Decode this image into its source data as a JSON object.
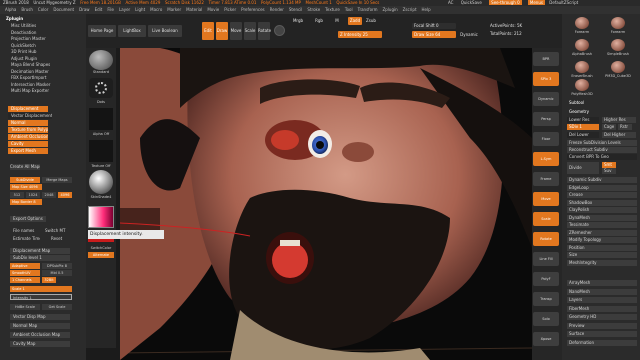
{
  "titlebar": {
    "app": "ZBrush 2018",
    "doc": "Uncut Mygeometry Z",
    "free_mem": "Free Mem 18.201GB",
    "active_mem": "Active Mem 4029",
    "scratch": "Scratch Disk 11622",
    "timer": "Timer 7.813 ATime 0.01",
    "polycount": "PolyCount 1.134 MP",
    "meshcount": "MeshCount 1",
    "quicksave": "QuickSave In 10 Secs",
    "ac": "AC",
    "qs": "QuickSave",
    "see_through": "See-through 0",
    "menus": "Menus",
    "default_script": "DefaultZScript"
  },
  "menubar": [
    "Alpha",
    "Brush",
    "Color",
    "Document",
    "Draw",
    "Edit",
    "File",
    "Layer",
    "Light",
    "Macro",
    "Marker",
    "Material",
    "Movie",
    "Picker",
    "Preferences",
    "Render",
    "Stencil",
    "Stroke",
    "Texture",
    "Tool",
    "Transform",
    "Zplugin",
    "Zscript",
    "Help"
  ],
  "left": {
    "title": "Zplugin",
    "items": [
      "Misc Utilities",
      "Deactivation",
      "Projection Master",
      "QuickSketch",
      "3D Print Hub",
      "Adjust Plugin",
      "Maya Blend Shapes",
      "Decimation Master",
      "FBX ExportImport",
      "Intersection Masker",
      "Multi Map Exporter"
    ],
    "sub": [
      "Displacement",
      "Vector Displacement",
      "Normal",
      "Texture from Polypaint",
      "Ambient Occlusion",
      "Cavity",
      "Export Mesh"
    ],
    "create_all": "Create All Maps",
    "subdiv": "SubDivide",
    "merge": "Merge Maps",
    "map_size_label": "Map Size",
    "map_size": "4096",
    "sizes": [
      "512",
      "1024",
      "2048",
      "4096"
    ],
    "map_border_label": "Map Border",
    "map_border": "8",
    "export_options": "Export Options",
    "file_names": "File names",
    "switch_mt": "Switch MT",
    "estimate": "Estimate Time",
    "reset": "Reset",
    "disp_map": "Displacement Map",
    "subdiv_level": "SubDiv level 1",
    "adaptive": "Adaptive",
    "dpsubpix": "DPSubPix 8",
    "smooth_uv": "SmoothUV",
    "mid": "Mid 0.5",
    "channels": "1 Channels",
    "bits": "32Bit",
    "scale": "Scale 1",
    "intensity": "Intensity 1",
    "hdr": "HdBe Scale",
    "get_scale": "Get Scale",
    "vec_disp": "Vector Disp Map",
    "normal_map": "Normal Map",
    "ao_map": "Ambient Occlusion Map",
    "cavity_map": "Cavity Map"
  },
  "shelf": {
    "home": "Home Page",
    "lightbox": "LightBox",
    "liveboolean": "Live Boolean",
    "edit": "Edit",
    "draw": "Draw",
    "move": "Move",
    "scale": "Scale",
    "rotate": "Rotate",
    "mrgb": "Mrgb",
    "rgb": "Rgb",
    "m": "M",
    "zadd": "Zadd",
    "zsub": "Zsub",
    "z_intensity": "Z Intensity 25",
    "focal_shift": "Focal Shift 0",
    "draw_size": "Draw Size 64",
    "dynamic": "Dynamic",
    "active_points": "ActivePoints: 5K",
    "total_points": "TotalPoints: 212"
  },
  "brushcol": {
    "standard": "Standard",
    "dots": "Dots",
    "alpha_off": "Alpha Off",
    "texture_off": "Texture Off",
    "matcap": "SkinShade4",
    "switch_color": "SwitchColor",
    "alternate": "Alternate",
    "gradient": "Gradient"
  },
  "tooltip": "Displacement intensity.",
  "rightstrip": [
    "BPR",
    "SPix 3",
    "Dynamic",
    "Persp",
    "Floor",
    "L.Sym",
    "Frame",
    "Move",
    "Scale",
    "Rotate",
    "Line Fill",
    "PolyF",
    "Transp",
    "Solo",
    "Xpose"
  ],
  "right": {
    "brush_thumbs": [
      "Forearm",
      "Forearm",
      "AlphaBrush",
      "SimpleBrush",
      "EraserBrush",
      "PM3D_Cube3D",
      "PolyMesh3D"
    ],
    "subtool": "Subtool",
    "geometry": "Geometry",
    "lower_res": "Lower Res",
    "higher_res": "Higher Res",
    "sdiv": "SDiv 1",
    "cage": "Cage",
    "rstr": "Rstr",
    "del_lower": "Del Lower",
    "del_higher": "Del Higher",
    "freeze": "Freeze SubDivision Levels",
    "reconstruct": "Reconstruct Subdiv",
    "convert": "Convert BPR To Geo",
    "divide": "Divide",
    "smt": "Smt",
    "suv": "Suv",
    "items": [
      "Dynamic Subdiv",
      "EdgeLoop",
      "Crease",
      "ShadowBox",
      "ClayPolish",
      "DynaMesh",
      "Tessimate",
      "ZRemesher",
      "Modify Topology",
      "Position",
      "Size",
      "MeshIntegrity"
    ],
    "items2": [
      "ArrayMesh",
      "NanoMesh",
      "Layers",
      "FiberMesh",
      "Geometry HD",
      "Preview",
      "Surface",
      "Deformation"
    ]
  }
}
